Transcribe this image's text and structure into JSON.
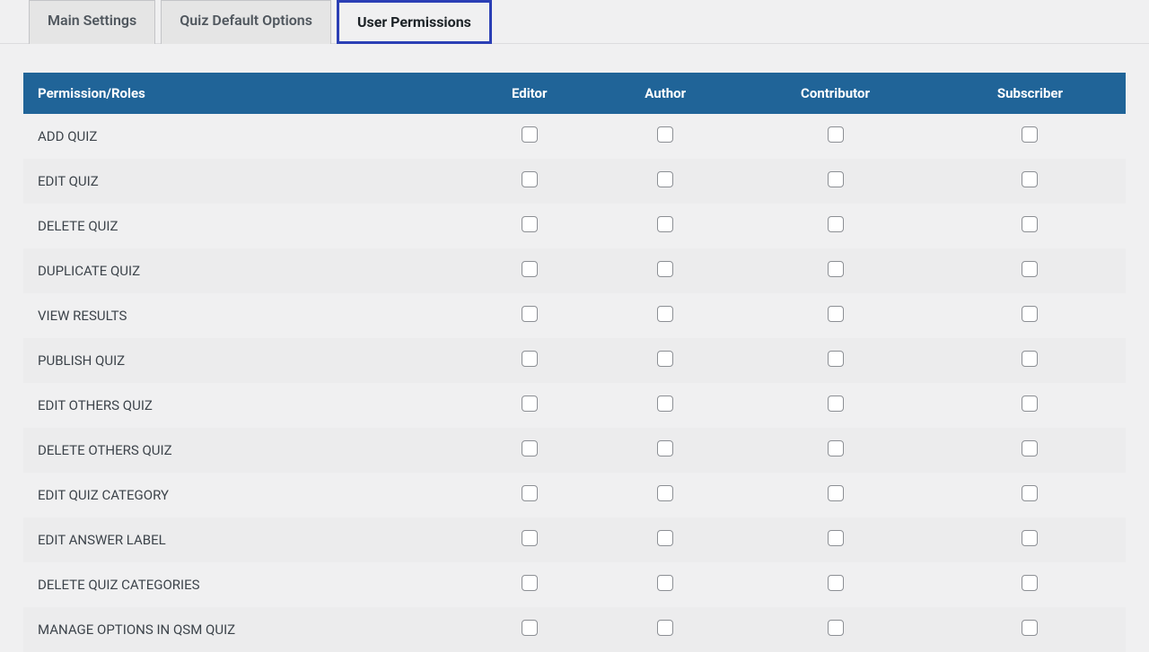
{
  "tabs": [
    {
      "label": "Main Settings",
      "active": false
    },
    {
      "label": "Quiz Default Options",
      "active": false
    },
    {
      "label": "User Permissions",
      "active": true
    }
  ],
  "table": {
    "headers": [
      "Permission/Roles",
      "Editor",
      "Author",
      "Contributor",
      "Subscriber"
    ],
    "rows": [
      {
        "permission": "ADD QUIZ",
        "editor": false,
        "author": false,
        "contributor": false,
        "subscriber": false
      },
      {
        "permission": "EDIT QUIZ",
        "editor": false,
        "author": false,
        "contributor": false,
        "subscriber": false
      },
      {
        "permission": "DELETE QUIZ",
        "editor": false,
        "author": false,
        "contributor": false,
        "subscriber": false
      },
      {
        "permission": "DUPLICATE QUIZ",
        "editor": false,
        "author": false,
        "contributor": false,
        "subscriber": false
      },
      {
        "permission": "VIEW RESULTS",
        "editor": false,
        "author": false,
        "contributor": false,
        "subscriber": false
      },
      {
        "permission": "PUBLISH QUIZ",
        "editor": false,
        "author": false,
        "contributor": false,
        "subscriber": false
      },
      {
        "permission": "EDIT OTHERS QUIZ",
        "editor": false,
        "author": false,
        "contributor": false,
        "subscriber": false
      },
      {
        "permission": "DELETE OTHERS QUIZ",
        "editor": false,
        "author": false,
        "contributor": false,
        "subscriber": false
      },
      {
        "permission": "EDIT QUIZ CATEGORY",
        "editor": false,
        "author": false,
        "contributor": false,
        "subscriber": false
      },
      {
        "permission": "EDIT ANSWER LABEL",
        "editor": false,
        "author": false,
        "contributor": false,
        "subscriber": false
      },
      {
        "permission": "DELETE QUIZ CATEGORIES",
        "editor": false,
        "author": false,
        "contributor": false,
        "subscriber": false
      },
      {
        "permission": "MANAGE OPTIONS IN QSM QUIZ",
        "editor": false,
        "author": false,
        "contributor": false,
        "subscriber": false
      }
    ]
  }
}
